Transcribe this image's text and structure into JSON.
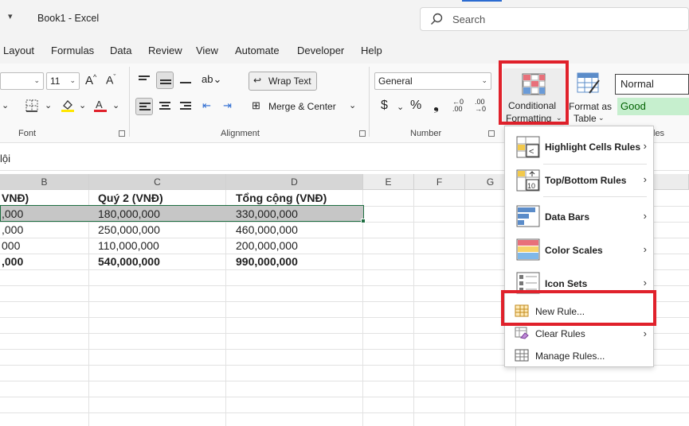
{
  "window": {
    "title": "Book1  -  Excel",
    "search_placeholder": "Search"
  },
  "tabs": [
    "Layout",
    "Formulas",
    "Data",
    "Review",
    "View",
    "Automate",
    "Developer",
    "Help"
  ],
  "ribbon": {
    "font": {
      "font_size": "11",
      "label": "Font"
    },
    "alignment": {
      "wrap_text": "Wrap Text",
      "merge_center": "Merge & Center",
      "label": "Alignment"
    },
    "number": {
      "format": "General",
      "label": "Number",
      "currency": "$",
      "percent": "%",
      "comma": "❟"
    },
    "conditional_formatting": {
      "line1": "Conditional",
      "line2": "Formatting"
    },
    "format_as_table": {
      "line1": "Format as",
      "line2": "Table"
    },
    "styles": {
      "normal": "Normal",
      "good": "Good",
      "label_partial": "les"
    }
  },
  "formula_bar": {
    "text": "lội"
  },
  "grid": {
    "columns": [
      "B",
      "C",
      "D",
      "E",
      "F",
      "G"
    ],
    "rows": [
      [
        "VNĐ)",
        "Quý 2 (VNĐ)",
        "Tổng cộng (VNĐ)"
      ],
      [
        ",000",
        "180,000,000",
        "330,000,000"
      ],
      [
        ",000",
        "250,000,000",
        "460,000,000"
      ],
      [
        "000",
        "110,000,000",
        "200,000,000"
      ],
      [
        ",000",
        "540,000,000",
        "990,000,000"
      ]
    ]
  },
  "cf_menu": {
    "items": [
      {
        "label": "Highlight Cells Rules",
        "has_submenu": true
      },
      {
        "label": "Top/Bottom Rules",
        "has_submenu": true
      },
      {
        "label": "Data Bars",
        "has_submenu": true
      },
      {
        "label": "Color Scales",
        "has_submenu": true
      },
      {
        "label": "Icon Sets",
        "has_submenu": true
      },
      {
        "label": "New Rule...",
        "has_submenu": false
      },
      {
        "label": "Clear Rules",
        "has_submenu": true
      },
      {
        "label": "Manage Rules...",
        "has_submenu": false
      }
    ],
    "chevron": "›"
  },
  "colors": {
    "highlight_box": "#e0212b",
    "selection_border": "#1e6e41",
    "good_fill": "#c6efce",
    "good_text": "#006100"
  }
}
